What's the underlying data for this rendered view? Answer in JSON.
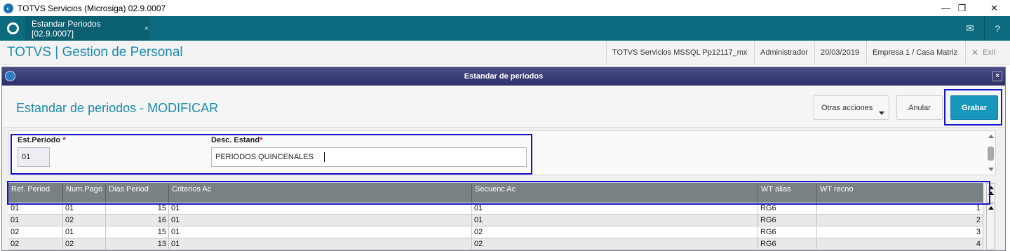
{
  "window": {
    "title": "TOTVS Servicios (Microsiga) 02.9.0007",
    "minimize": "—",
    "restore": "❐",
    "close": "✕"
  },
  "tabbar": {
    "tab_label": "Estandar Periodos [02.9.0007]",
    "tab_close": "×",
    "mail_icon": "✉",
    "help_icon": "?"
  },
  "header": {
    "brand": "TOTVS | Gestion de Personal",
    "environment": "TOTVS Servicios MSSQL Pp12117_mx",
    "user": "Administrador",
    "date": "20/03/2019",
    "company": "Empresa 1 / Casa Matriz",
    "exit_icon": "✕",
    "exit_label": "Exit"
  },
  "dialog": {
    "title": "Estandar de periodos",
    "close": "×",
    "heading": "Estandar de periodos - MODIFICAR",
    "buttons": {
      "otras_acciones": "Otras acciones",
      "anular": "Anular",
      "grabar": "Grabar"
    }
  },
  "form": {
    "est_periodo_label": "Est.Periodo",
    "est_periodo_value": "01",
    "desc_estand_label": "Desc. Estand",
    "desc_estand_value": "PERIODOS QUINCENALES",
    "required_mark": "*"
  },
  "grid": {
    "columns": [
      "Ref. Period",
      "Num.Pago",
      "Dias Period",
      "Criterios Ac",
      "Secuenc Ac",
      "WT alias",
      "WT recno"
    ],
    "rows": [
      [
        "01",
        "01",
        "15",
        "01",
        "01",
        "RG6",
        "1"
      ],
      [
        "01",
        "02",
        "16",
        "01",
        "01",
        "RG6",
        "2"
      ],
      [
        "02",
        "01",
        "15",
        "01",
        "02",
        "RG6",
        "3"
      ],
      [
        "02",
        "02",
        "13",
        "01",
        "02",
        "RG6",
        "4"
      ]
    ]
  },
  "colors": {
    "tabbar": "#0c6b7e",
    "brand": "#1a8bb0",
    "grabar": "#1898bd",
    "dialog_title": "#2d306a",
    "highlight": "#1414c8",
    "grid_header": "#7a8185"
  }
}
